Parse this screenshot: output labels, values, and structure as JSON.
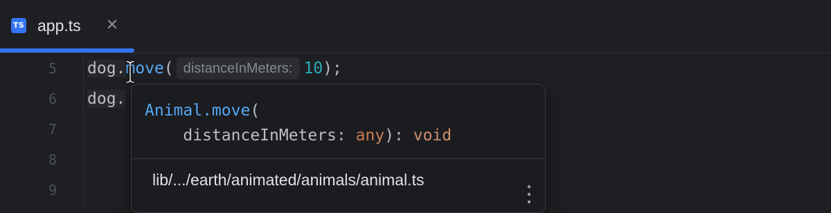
{
  "tab": {
    "icon_text": "TS",
    "label": "app.ts",
    "close_glyph": "✕"
  },
  "gutter": {
    "line_numbers": [
      "5",
      "6",
      "7",
      "8",
      "9"
    ]
  },
  "code": {
    "line5": {
      "object": "dog.",
      "method": "move",
      "open_paren": "(",
      "hint": "distanceInMeters:",
      "argument": "10",
      "close": ");"
    },
    "line6": {
      "object": "dog."
    }
  },
  "popup": {
    "signature_fn": "Animal.move",
    "signature_open": "(",
    "param_indent": "    ",
    "param_name": "distanceInMeters: ",
    "param_type": "any",
    "param_close": "): ",
    "return_type": "void",
    "path": "lib/.../earth/animated/animals/animal.ts",
    "more_icon": "more-vertical-icon"
  },
  "colors": {
    "accent": "#3574f0",
    "function": "#56a8f5",
    "number": "#2aacb8",
    "type": "#c77d55",
    "background": "#1e1f22"
  }
}
